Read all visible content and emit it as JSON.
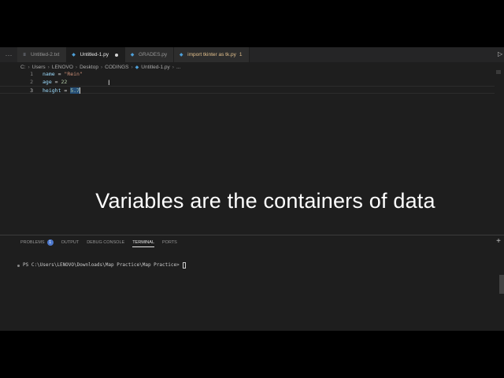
{
  "tabs": [
    {
      "label": "Untitled-2.txt",
      "icon": "text-file-icon",
      "active": false
    },
    {
      "label": "Untitled-1.py",
      "icon": "python-file-icon",
      "active": true,
      "modified": true
    },
    {
      "label": "GRADES.py",
      "icon": "python-file-icon",
      "active": false
    },
    {
      "label": "import tkinter as tk.py",
      "warning_count": "1",
      "icon": "python-file-icon",
      "active": false
    }
  ],
  "breadcrumb": [
    "C:",
    "Users",
    "LENOVO",
    "Desktop",
    "CODINGS",
    "Untitled-1.py",
    "..."
  ],
  "editor": {
    "lines": [
      {
        "number": "1",
        "var": "name",
        "op": " = ",
        "value": "\"Rein\""
      },
      {
        "number": "2",
        "var": "age",
        "op": " = ",
        "value": "22"
      },
      {
        "number": "3",
        "var": "height",
        "op": " = ",
        "value": "5.7"
      }
    ]
  },
  "caption": "Variables are the containers of data",
  "panel": {
    "tabs": [
      "PROBLEMS",
      "OUTPUT",
      "DEBUG CONSOLE",
      "TERMINAL",
      "PORTS"
    ],
    "problems_count": "1",
    "active_tab": "TERMINAL",
    "terminal_prompt": "PS C:\\Users\\LENOVO\\Downloads\\Map Practice\\Map Practice>"
  },
  "colors": {
    "editor_bg": "#1e1e1e",
    "variable": "#9cdcfe",
    "string": "#ce9178",
    "number": "#b5cea8",
    "warning": "#e2c08d",
    "badge": "#4d78cc"
  }
}
